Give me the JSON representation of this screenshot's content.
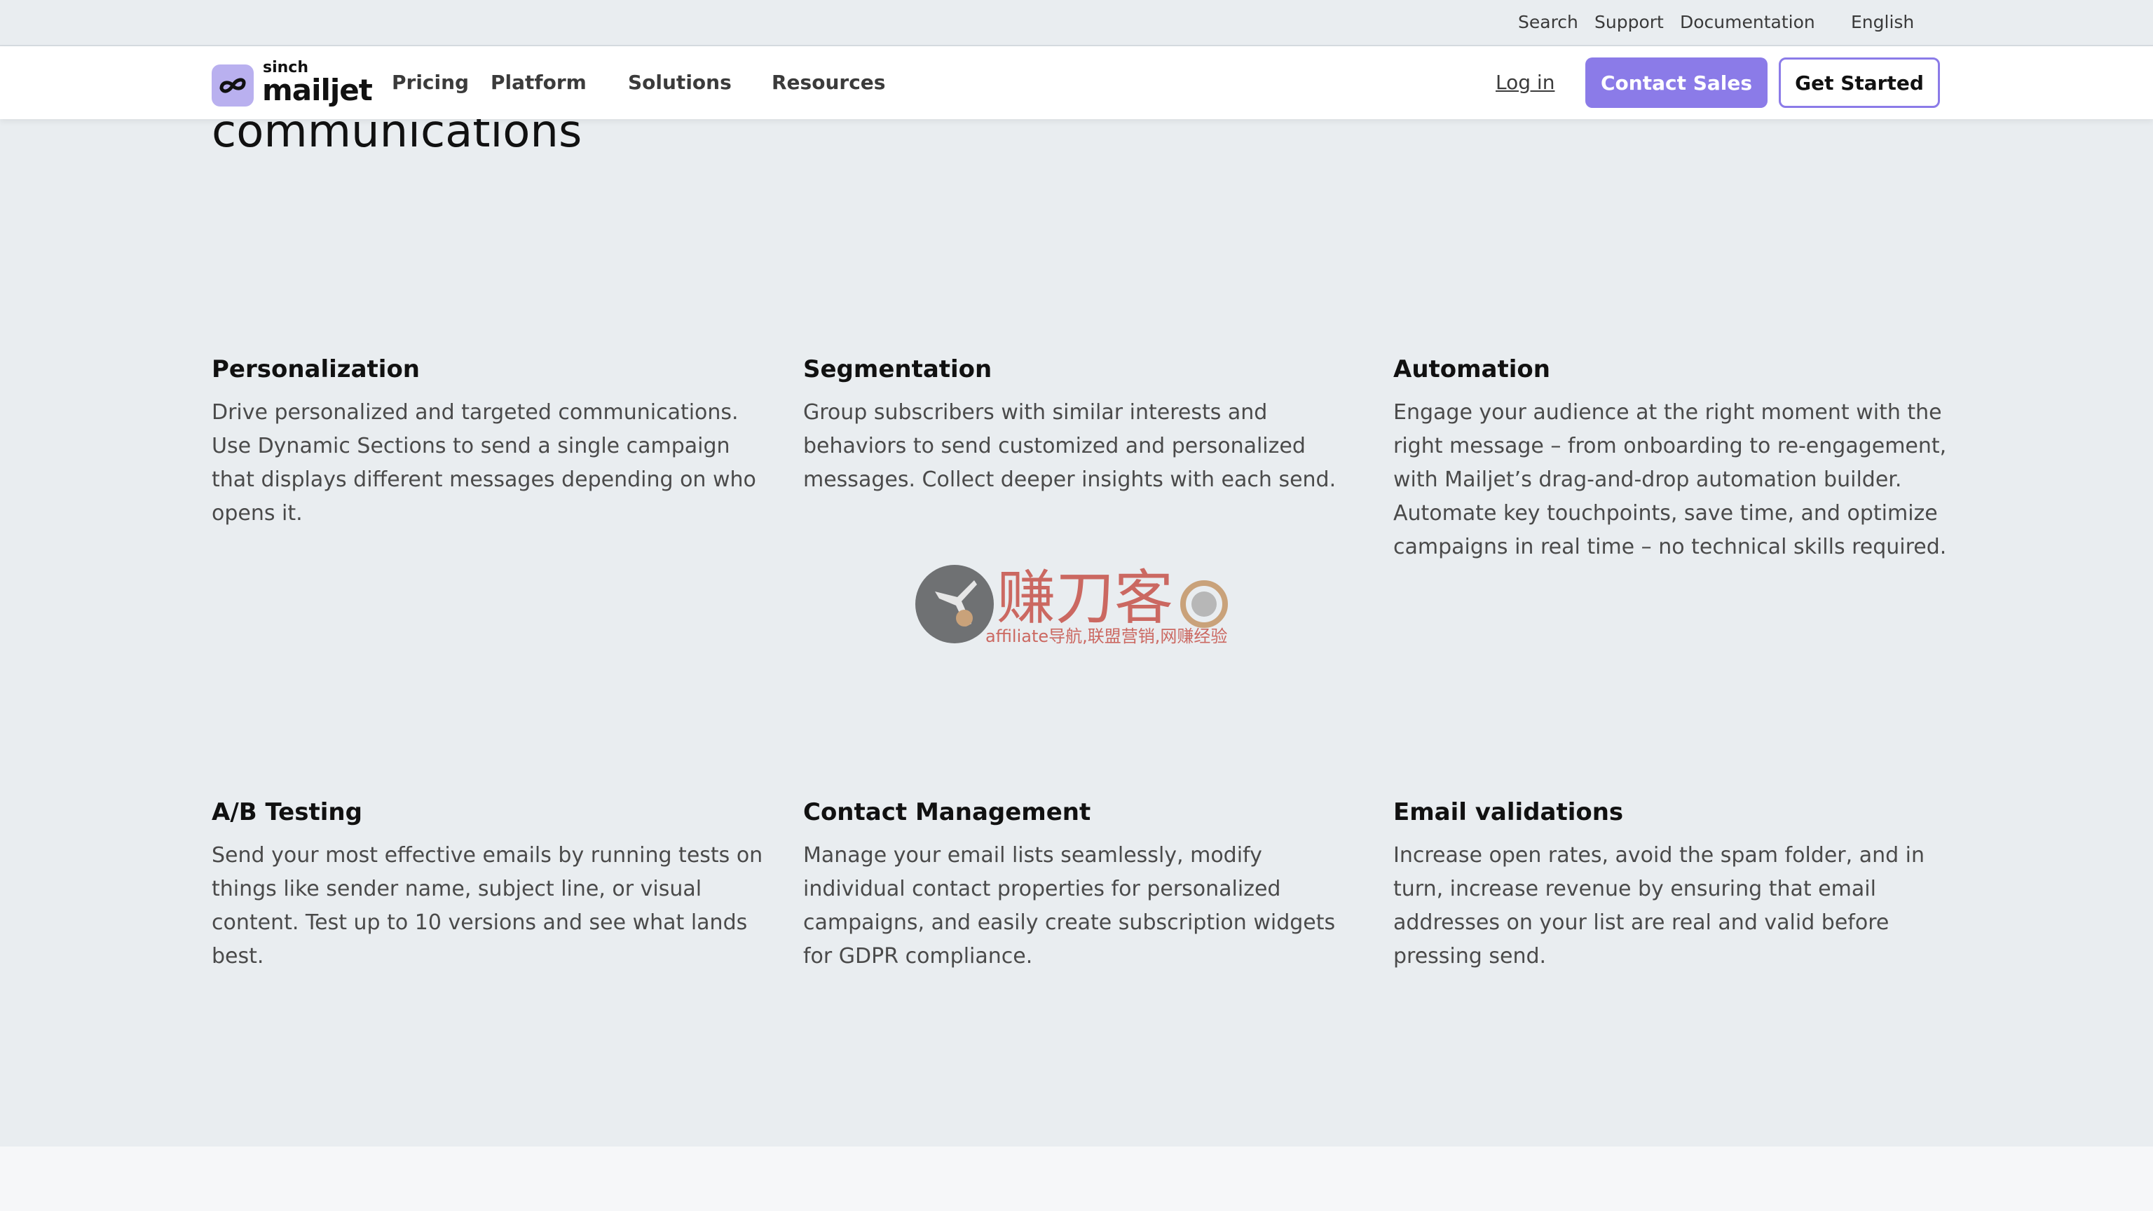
{
  "utility": {
    "search": "Search",
    "support": "Support",
    "documentation": "Documentation",
    "language": "English"
  },
  "nav": {
    "logo_top": "sinch",
    "logo_main": "mailjet",
    "pricing": "Pricing",
    "platform": "Platform",
    "solutions": "Solutions",
    "resources": "Resources",
    "login": "Log in",
    "contact_sales": "Contact Sales",
    "get_started": "Get Started"
  },
  "section": {
    "heading_fragment": "communications"
  },
  "features": [
    {
      "title": "Personalization",
      "body": "Drive personalized and targeted communications. Use Dynamic Sections to send a single campaign that displays different messages depending on who opens it."
    },
    {
      "title": "Segmentation",
      "body": "Group subscribers with similar interests and behaviors to send customized and personalized messages. Collect deeper insights with each send."
    },
    {
      "title": "Automation",
      "body": "Engage your audience at the right moment with the right message – from onboarding to re-engagement, with Mailjet’s drag-and-drop automation builder. Automate key touchpoints, save time, and optimize campaigns in real time – no technical skills required."
    },
    {
      "title": "A/B Testing",
      "body": "Send your most effective emails by running tests on things like sender name, subject line, or visual content. Test up to 10 versions and see what lands best."
    },
    {
      "title": "Contact Management",
      "body": "Manage your email lists seamlessly, modify individual contact properties for personalized campaigns, and easily create subscription widgets for GDPR compliance."
    },
    {
      "title": "Email validations",
      "body": "Increase open rates, avoid the spam folder, and in turn, increase revenue by ensuring that email addresses on your list are real and valid before pressing send."
    }
  ],
  "watermark": {
    "title": "赚刀客",
    "subtitle": "affiliate导航,联盟营销,网赚经验"
  },
  "colors": {
    "accent": "#8b7be8",
    "background": "#e9edf0",
    "logo_badge": "#b9b0ef"
  }
}
